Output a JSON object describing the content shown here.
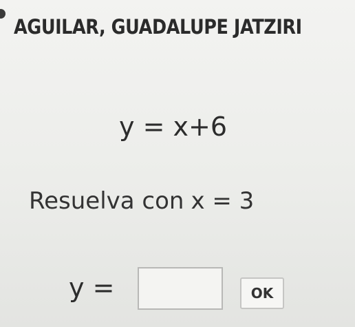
{
  "header": {
    "student_name": "AGUILAR, GUADALUPE JATZIRI"
  },
  "problem": {
    "equation": "y = x+6",
    "instruction_prefix": "Resuelva con",
    "instruction_condition": "x = 3"
  },
  "answer": {
    "label": "y =",
    "value": "",
    "submit_label": "OK"
  }
}
